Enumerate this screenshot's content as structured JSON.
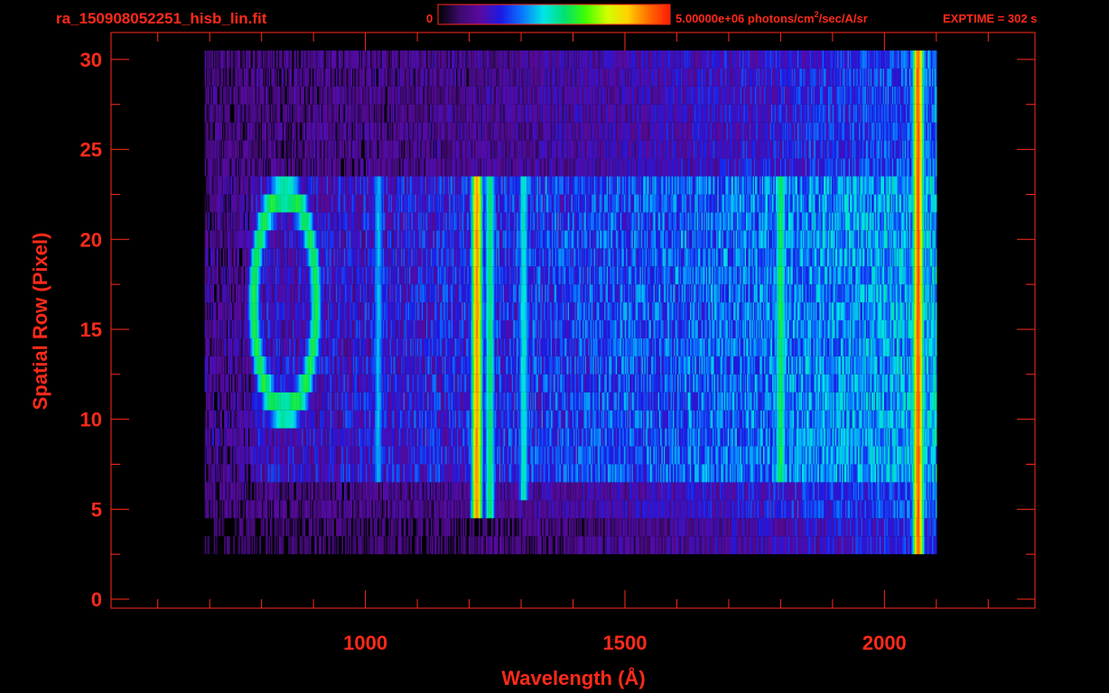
{
  "header": {
    "filename": "ra_150908052251_hisb_lin.fit",
    "colorbar_min_label": "0",
    "colorbar_max_label": "5.00000e+06 photons/cm",
    "colorbar_max_label_exponent": "2",
    "colorbar_max_label_suffix": "/sec/A/sr",
    "exptime_label": "EXPTIME = 302 s"
  },
  "colors": {
    "background": "#000000",
    "axis": "#ff2a1a",
    "text": "#ff2a1a",
    "colormap": [
      "#000000",
      "#3a0a6a",
      "#5a0aa0",
      "#1a1ae6",
      "#0a78ff",
      "#00e6e6",
      "#00e070",
      "#40ff00",
      "#d0ff00",
      "#ffd000",
      "#ff6a00",
      "#ff1a00"
    ]
  },
  "chart_data": {
    "type": "heatmap",
    "title": "",
    "xlabel": "Wavelength (Å)",
    "ylabel": "Spatial Row (Pixel)",
    "xlim": [
      510,
      2290
    ],
    "ylim": [
      -0.5,
      31.5
    ],
    "xticks": [
      1000,
      1500,
      2000
    ],
    "xtick_labels": [
      "1000",
      "1500",
      "2000"
    ],
    "yticks": [
      0,
      5,
      10,
      15,
      20,
      25,
      30
    ],
    "ytick_labels": [
      "0",
      "5",
      "10",
      "15",
      "20",
      "25",
      "30"
    ],
    "value_units": "photons/cm^2/sec/A/sr",
    "value_range": [
      0,
      5000000
    ],
    "colorbar": "rainbow (black-purple-blue-cyan-green-yellow-red)",
    "data_extent": {
      "x_range": [
        690,
        2100
      ],
      "row_range": [
        3,
        30
      ],
      "slit_rows": [
        7,
        23
      ]
    },
    "features": [
      {
        "x": 845,
        "rows": [
          10,
          23
        ],
        "level": 0.58,
        "note": "ring-shaped bright region"
      },
      {
        "x": 1025,
        "rows": [
          7,
          23
        ],
        "level": 0.42
      },
      {
        "x": 1215,
        "rows": [
          5,
          23
        ],
        "level": 0.88,
        "note": "strongest line"
      },
      {
        "x": 1240,
        "rows": [
          5,
          23
        ],
        "level": 0.55
      },
      {
        "x": 1305,
        "rows": [
          6,
          23
        ],
        "level": 0.48
      },
      {
        "x": 1800,
        "rows": [
          7,
          23
        ],
        "level": 0.58
      },
      {
        "x": 2065,
        "rows": [
          3,
          30
        ],
        "level": 0.93,
        "note": "red edge"
      }
    ],
    "grid": false,
    "legend": "colorbar top"
  }
}
